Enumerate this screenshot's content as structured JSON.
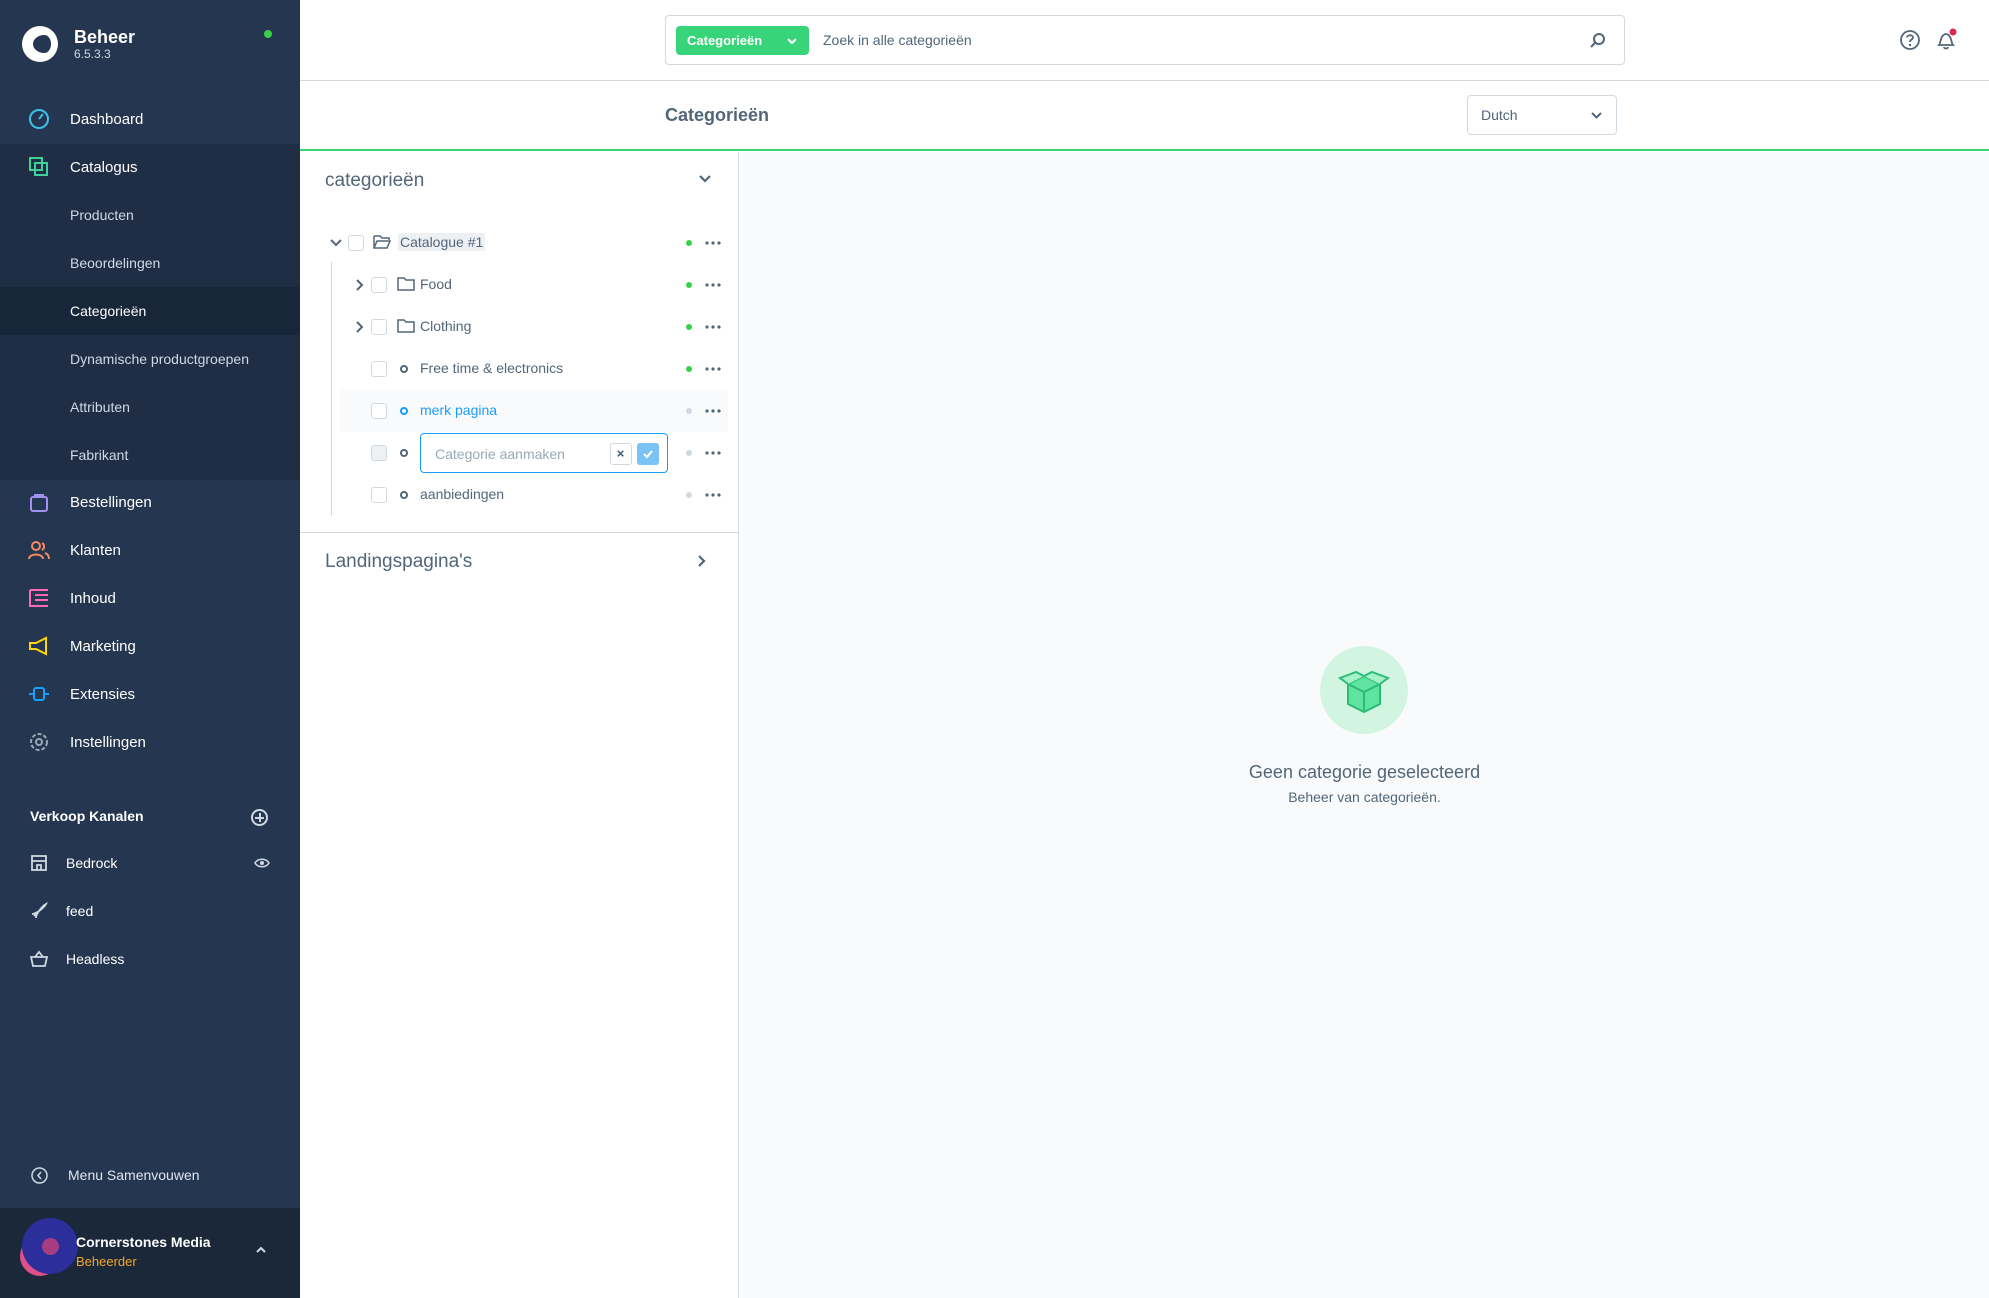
{
  "brand": {
    "title": "Beheer",
    "version": "6.5.3.3"
  },
  "nav": {
    "dashboard": "Dashboard",
    "catalogus": "Catalogus",
    "catalog_sub": [
      "Producten",
      "Beoordelingen",
      "Categorieën",
      "Dynamische productgroepen",
      "Attributen",
      "Fabrikant"
    ],
    "bestellingen": "Bestellingen",
    "klanten": "Klanten",
    "inhoud": "Inhoud",
    "marketing": "Marketing",
    "extensies": "Extensies",
    "instellingen": "Instellingen"
  },
  "sales_channels": {
    "title": "Verkoop Kanalen",
    "items": [
      "Bedrock",
      "feed",
      "Headless"
    ]
  },
  "collapse_label": "Menu Samenvouwen",
  "user": {
    "name": "Cornerstones Media",
    "role": "Beheerder"
  },
  "search": {
    "scope": "Categorieën",
    "placeholder": "Zoek in alle categorieën"
  },
  "page_title": "Categorieën",
  "language": "Dutch",
  "tree": {
    "header": "categorieën",
    "items": [
      {
        "label": "Catalogue #1",
        "active": true
      },
      {
        "label": "Food",
        "active": true
      },
      {
        "label": "Clothing",
        "active": true
      },
      {
        "label": "Free time & electronics",
        "active": true
      },
      {
        "label": "merk pagina",
        "active": false
      },
      {
        "label": "aanbiedingen",
        "active": false
      }
    ],
    "new_placeholder": "Categorie aanmaken"
  },
  "landing": {
    "title": "Landingspagina's"
  },
  "empty": {
    "title": "Geen categorie geselecteerd",
    "subtitle": "Beheer van categorieën."
  },
  "colors": {
    "accent": "#37d479",
    "sidebar": "#253650",
    "link": "#189eff",
    "status_active": "#37d046"
  }
}
